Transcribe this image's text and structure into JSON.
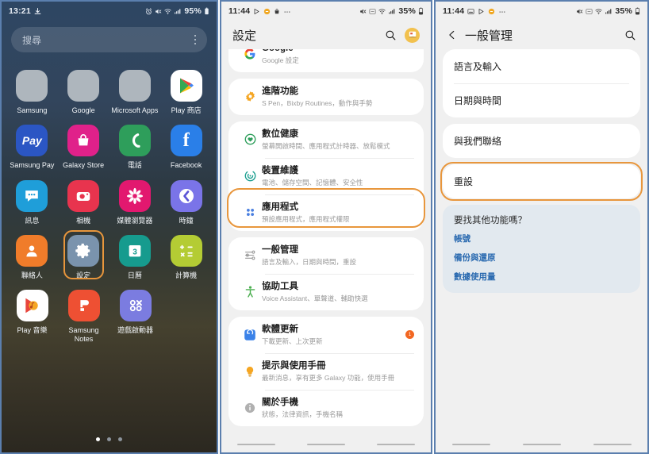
{
  "screen1": {
    "status": {
      "time": "13:21",
      "battery": "95%",
      "icons_left": [
        "download-icon"
      ],
      "icons_right": [
        "alarm-icon",
        "mute-icon",
        "wifi-icon",
        "signal-icon"
      ]
    },
    "search": {
      "placeholder": "搜尋",
      "menu": "more-options"
    },
    "apps": [
      [
        {
          "label": "Samsung",
          "type": "folder",
          "colors": [
            "#3ddad7",
            "#e2574c",
            "#e2574c",
            "#f5a623",
            "#3b7dd8",
            "#f5a623",
            "#2f80ed",
            "#6c63ff",
            "#8e6fd8"
          ]
        },
        {
          "label": "Google",
          "type": "folder",
          "colors": [
            "#4285f4",
            "#34a853",
            "#ea4335",
            "#34a853",
            "#ea4335",
            "#4285f4",
            "#ea4335",
            "#4285f4",
            "#34a853"
          ]
        },
        {
          "label": "Microsoft Apps",
          "type": "folder",
          "colors": [
            "#ffffff00",
            "#28a8ea",
            "#0078d4",
            "#ffffff00",
            "#ffffff00",
            "#ffffff00",
            "#ffffff00",
            "#ffffff00",
            "#ffffff00"
          ]
        },
        {
          "label": "Play 商店",
          "type": "play-store",
          "bg": "#ffffff"
        }
      ],
      [
        {
          "label": "Samsung Pay",
          "type": "samsung-pay",
          "bg": "#2b56c4"
        },
        {
          "label": "Galaxy Store",
          "type": "galaxy-store",
          "bg": "#e0218a"
        },
        {
          "label": "電話",
          "type": "phone",
          "bg": "#2e9e5b"
        },
        {
          "label": "Facebook",
          "type": "facebook",
          "bg": "#2a7fe8"
        }
      ],
      [
        {
          "label": "訊息",
          "type": "messages",
          "bg": "#1f9ed9"
        },
        {
          "label": "相機",
          "type": "camera",
          "bg": "#e8344e"
        },
        {
          "label": "媒體瀏覽器",
          "type": "gallery",
          "bg": "#e2186f"
        },
        {
          "label": "時鐘",
          "type": "clock",
          "bg": "#7a74e8"
        }
      ],
      [
        {
          "label": "聯絡人",
          "type": "contacts",
          "bg": "#f07c2a"
        },
        {
          "label": "設定",
          "type": "settings",
          "bg": "#7a93ad",
          "highlighted": true
        },
        {
          "label": "日曆",
          "type": "calendar",
          "bg": "#169b8e",
          "day": "3"
        },
        {
          "label": "計算機",
          "type": "calculator",
          "bg": "#b4cc34"
        }
      ],
      [
        {
          "label": "Play 音樂",
          "type": "play-music",
          "bg": "#ffffff"
        },
        {
          "label": "Samsung Notes",
          "type": "samsung-notes",
          "bg": "#ee5033"
        },
        {
          "label": "遊戲啟動器",
          "type": "game-launcher",
          "bg": "#7b7ce0"
        }
      ]
    ],
    "page_dots": {
      "count": 3,
      "active": 0
    }
  },
  "screen2": {
    "status": {
      "time": "11:44",
      "battery": "35%",
      "icons_left": [
        "play-icon",
        "pause-icon",
        "bag-icon",
        "more-icon"
      ],
      "icons_right": [
        "mute-icon",
        "nfc-icon",
        "wifi-icon",
        "signal-icon"
      ]
    },
    "title": "設定",
    "actions": {
      "search": "search-icon",
      "profile": "account-avatar"
    },
    "groups": [
      {
        "items": [
          {
            "title": "Google",
            "sub": "Google 設定",
            "icon": "google-icon",
            "partial": true
          }
        ]
      },
      {
        "items": [
          {
            "title": "進階功能",
            "sub": "S Pen，Bixby Routines，動作與手勢",
            "icon": "advanced-features-icon"
          }
        ]
      },
      {
        "items": [
          {
            "title": "數位健康",
            "sub": "螢幕開啟時間、應用程式計時器、放鬆模式",
            "icon": "digital-wellbeing-icon"
          },
          {
            "title": "裝置維護",
            "sub": "電池、儲存空間、記憶體、安全性",
            "icon": "device-care-icon"
          },
          {
            "title": "應用程式",
            "sub": "預設應用程式，應用程式權限",
            "icon": "apps-icon"
          }
        ]
      },
      {
        "items": [
          {
            "title": "一般管理",
            "sub": "語言及輸入，日期與時間，重設",
            "icon": "general-management-icon",
            "highlighted": true
          },
          {
            "title": "協助工具",
            "sub": "Voice Assistant、單聲道、輔助快選",
            "icon": "accessibility-icon"
          }
        ]
      },
      {
        "items": [
          {
            "title": "軟體更新",
            "sub": "下載更新、上次更新",
            "icon": "software-update-icon",
            "badge": "1"
          },
          {
            "title": "提示與使用手冊",
            "sub": "最新消息，享有更多 Galaxy 功能，使用手冊",
            "icon": "tips-icon"
          },
          {
            "title": "關於手機",
            "sub": "狀態，法律資訊，手機名稱",
            "icon": "about-phone-icon"
          }
        ]
      }
    ]
  },
  "screen3": {
    "status": {
      "time": "11:44",
      "battery": "35%",
      "icons_left": [
        "image-icon",
        "play-icon",
        "pause-icon",
        "more-icon"
      ],
      "icons_right": [
        "mute-icon",
        "nfc-icon",
        "wifi-icon",
        "signal-icon"
      ]
    },
    "back": "back-arrow",
    "title": "一般管理",
    "actions": {
      "search": "search-icon"
    },
    "group1": [
      {
        "title": "語言及輸入"
      },
      {
        "title": "日期與時間"
      }
    ],
    "group2": [
      {
        "title": "與我們聯絡"
      }
    ],
    "group3": [
      {
        "title": "重設",
        "highlighted": true
      }
    ],
    "info": {
      "heading": "要找其他功能嗎？",
      "links": [
        "帳號",
        "備份與還原",
        "數據使用量"
      ]
    }
  },
  "theme": {
    "highlight": "#e8963c",
    "link": "#2a6ab0",
    "panel_border": "#5b7fae"
  }
}
